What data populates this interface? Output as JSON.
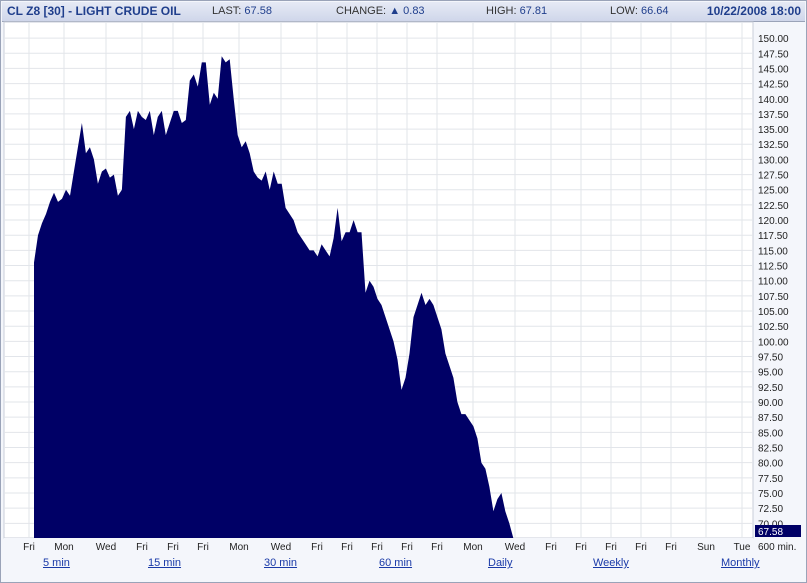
{
  "header": {
    "symbol_title": "CL Z8 [30] - LIGHT CRUDE OIL",
    "last_label": "LAST:",
    "last_value": "67.58",
    "change_label": "CHANGE:",
    "change_value": "0.83",
    "high_label": "HIGH:",
    "high_value": "67.81",
    "low_label": "LOW:",
    "low_value": "66.64",
    "datetime": "10/22/2008 18:00"
  },
  "chart_data": {
    "type": "area",
    "ylim": [
      67.58,
      151.5
    ],
    "yticks": [
      "150.00",
      "147.50",
      "145.00",
      "142.50",
      "140.00",
      "137.50",
      "135.00",
      "132.50",
      "130.00",
      "127.50",
      "125.00",
      "122.50",
      "120.00",
      "117.50",
      "115.00",
      "112.50",
      "110.00",
      "107.50",
      "105.00",
      "102.50",
      "100.00",
      "97.50",
      "95.00",
      "92.50",
      "90.00",
      "87.50",
      "85.00",
      "82.50",
      "80.00",
      "77.50",
      "75.00",
      "72.50",
      "70.00"
    ],
    "last_price_label": "67.58",
    "xticks": [
      "Fri",
      "Mon",
      "Wed",
      "Fri",
      "Fri",
      "Fri",
      "Mon",
      "Wed",
      "Fri",
      "Fri",
      "Fri",
      "Fri",
      "Fri",
      "Mon",
      "Wed",
      "Fri",
      "Fri",
      "Fri",
      "Fri",
      "Fri",
      "Sun",
      "Tue"
    ],
    "x_interval_label": "600 min.",
    "x": [
      0,
      2,
      4,
      6,
      8,
      10,
      12,
      14,
      16,
      18,
      20,
      22,
      24,
      26,
      28,
      30,
      32,
      34,
      36,
      38,
      40,
      42,
      44,
      46,
      48,
      50,
      52,
      54,
      56,
      58,
      60,
      62,
      64,
      66,
      68,
      70,
      72,
      74,
      76,
      78,
      80,
      82,
      84,
      86,
      88,
      90,
      92,
      94,
      96,
      98,
      100,
      102,
      104,
      106,
      108,
      110,
      112,
      114,
      116,
      118,
      120,
      122,
      124,
      126,
      128,
      130,
      132,
      134,
      136,
      138,
      140,
      142,
      144,
      146,
      148,
      150,
      152,
      154,
      156,
      158,
      160,
      162,
      164,
      166,
      168,
      170,
      172,
      174,
      176,
      178,
      180,
      182,
      184,
      186,
      188,
      190,
      192,
      194,
      196,
      198,
      200,
      202,
      204,
      206,
      208,
      210,
      212,
      214,
      216,
      218,
      220,
      222,
      224,
      226,
      228,
      230,
      232,
      234,
      236,
      238,
      240,
      242,
      244,
      246,
      248,
      250,
      252,
      254,
      256,
      258,
      260,
      262,
      264,
      266,
      268,
      270,
      272,
      274,
      276,
      278,
      280,
      282,
      284,
      286,
      288,
      290,
      292,
      294,
      296,
      298,
      300,
      302,
      304,
      306,
      308,
      310,
      312,
      314,
      316,
      318,
      320,
      322,
      324,
      326,
      328,
      330,
      332,
      334,
      336,
      338,
      340,
      342,
      344,
      346,
      348,
      350,
      352,
      354,
      356,
      358,
      360
    ],
    "values": [
      113,
      117.5,
      119.5,
      121,
      123,
      124.5,
      123,
      123.5,
      125,
      124,
      128,
      132,
      136,
      131,
      132,
      130,
      126,
      128,
      128.5,
      127,
      127.5,
      124,
      125,
      137,
      138,
      135,
      138,
      137,
      136.5,
      138,
      134,
      137,
      138,
      134,
      136,
      138,
      138,
      136,
      136.5,
      143,
      144,
      142,
      146,
      146,
      139,
      141,
      140,
      147,
      146,
      146.5,
      140,
      134,
      132,
      133,
      131,
      128,
      127,
      126.5,
      128,
      125,
      128,
      126,
      126,
      122,
      121,
      120,
      118,
      117,
      116,
      115,
      115,
      114,
      116,
      115,
      114,
      117,
      122,
      116.5,
      118,
      118,
      120,
      118,
      118,
      108,
      110,
      109,
      107,
      106,
      104,
      102,
      100,
      97,
      92,
      94,
      98,
      104,
      106,
      108,
      106,
      107,
      106,
      104,
      102,
      98,
      96,
      94,
      90,
      88,
      88,
      87,
      86,
      84,
      80,
      79,
      76,
      72,
      74,
      75,
      72,
      70,
      67.58,
      67.58,
      67.58,
      67.58,
      67.58,
      67.58,
      67.58,
      67.58,
      67.58,
      67.58,
      67.58,
      67.58,
      67.58,
      67.58,
      67.58,
      67.58,
      67.58,
      67.58,
      67.58,
      67.58,
      67.58,
      67.58,
      67.58,
      67.58,
      67.58,
      67.58,
      67.58,
      67.58,
      67.58,
      67.58,
      67.58,
      67.58,
      67.58,
      67.58,
      67.58,
      67.58,
      67.58,
      67.58,
      67.58,
      67.58,
      67.58,
      67.58,
      67.58,
      67.58,
      67.58,
      67.58,
      67.58,
      67.58,
      67.58,
      67.58,
      67.58,
      67.58,
      67.58,
      67.58,
      67.58,
      67.58
    ],
    "grid": true,
    "fill_color": "#000066"
  },
  "tabs": [
    "5 min",
    "15 min",
    "30 min",
    "60 min",
    "Daily",
    "Weekly",
    "Monthly"
  ]
}
